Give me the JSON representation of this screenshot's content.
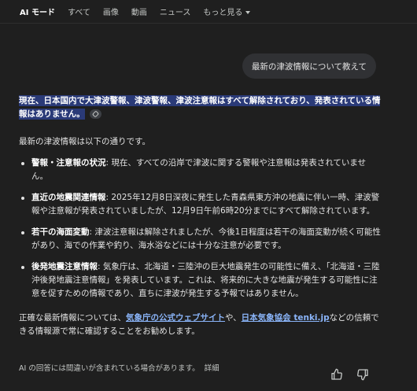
{
  "tabs": [
    {
      "label": "AI モード",
      "active": true
    },
    {
      "label": "すべて"
    },
    {
      "label": "画像"
    },
    {
      "label": "動画"
    },
    {
      "label": "ニュース"
    },
    {
      "label": "もっと見る"
    }
  ],
  "query": "最新の津波情報について教えて",
  "answer": {
    "highlight_line": "現在、日本国内で大津波警報、津波警報、津波注意報はすべて解除されており、発表されている情報はありません。",
    "intro": "最新の津波情報は以下の通りです。",
    "bullets": [
      {
        "title": "警報・注意報の状況",
        "text": ": 現在、すべての沿岸で津波に関する警報や注意報は発表されていません。"
      },
      {
        "title": "直近の地震関連情報",
        "text": ": 2025年12月8日深夜に発生した青森県東方沖の地震に伴い一時、津波警報や注意報が発表されていましたが、12月9日午前6時20分までにすべて解除されています。"
      },
      {
        "title": "若干の海面変動",
        "text": ": 津波注意報は解除されましたが、今後1日程度は若干の海面変動が続く可能性があり、海での作業や釣り、海水浴などには十分な注意が必要です。"
      },
      {
        "title": "後発地震注意情報",
        "text": ": 気象庁は、北海道・三陸沖の巨大地震発生の可能性に備え、「北海道・三陸沖後発地震注意情報」を発表しています。これは、将来的に大きな地震が発生する可能性に注意を促すための情報であり、直ちに津波が発生する予報ではありません。"
      }
    ],
    "outro_prefix": "正確な最新情報については、",
    "link1": "気象庁の公式ウェブサイト",
    "outro_mid": "や、",
    "link2": "日本気象協会 tenki.jp",
    "outro_suffix": "などの信頼できる情報源で常に確認することをお勧めします。"
  },
  "footer": {
    "disclaimer": "AI の回答には間違いが含まれている場合があります。",
    "detail": "詳細"
  },
  "icons": {
    "thumbs_up": "thumbs-up-icon",
    "thumbs_down": "thumbs-down-icon"
  },
  "colors": {
    "background": "#1f1f1f",
    "highlight": "#2a3a78",
    "link": "#8ab4f8",
    "bubble": "#303134"
  }
}
